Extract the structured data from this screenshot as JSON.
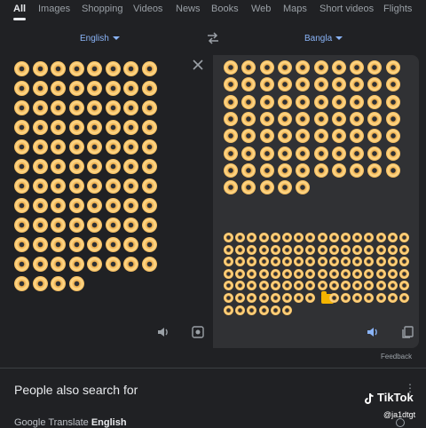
{
  "tabs": [
    {
      "label": "All",
      "active": true
    },
    {
      "label": "Images"
    },
    {
      "label": "Shopping"
    },
    {
      "label": "Videos"
    },
    {
      "label": "News"
    },
    {
      "label": "Books"
    },
    {
      "label": "Web"
    },
    {
      "label": "Maps"
    },
    {
      "label": "Short videos"
    },
    {
      "label": "Flights"
    }
  ],
  "translate": {
    "source_lang": "English",
    "target_lang": "Bangla",
    "source_donut_count": 92,
    "target_large_count": 75,
    "target_small_count": 102
  },
  "colors": {
    "background": "#202124",
    "panel": "#303134",
    "accent": "#8ab4f8",
    "donut": "#f7c56a"
  },
  "icons": {
    "clear": "close-icon",
    "swap": "swap-icon",
    "speaker": "speaker-icon",
    "camera": "camera-icon",
    "copy": "copy-icon"
  },
  "feedback_label": "Feedback",
  "people_also_search": {
    "title": "People also search for",
    "item_prefix": "Google Translate ",
    "item_bold": "English"
  },
  "watermark": {
    "brand": "TikTok",
    "handle": "@ja1dtgt"
  }
}
